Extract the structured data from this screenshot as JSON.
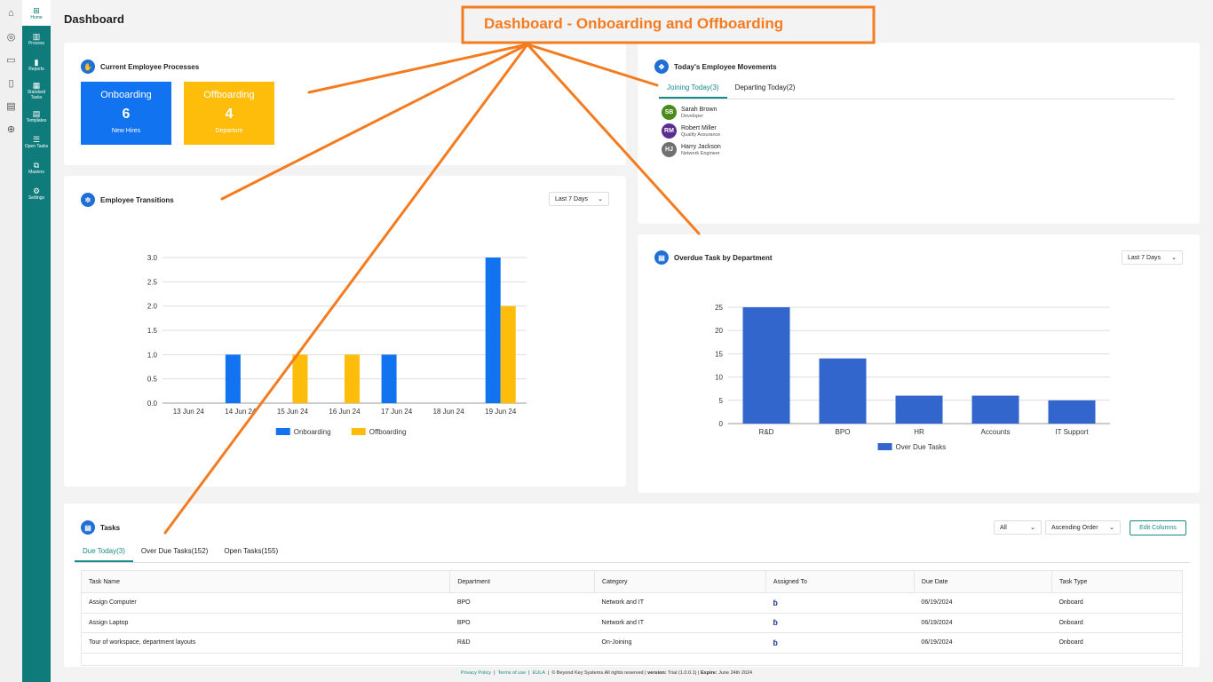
{
  "rail": {
    "icons": [
      "home-icon",
      "globe-icon",
      "id-card-icon",
      "document-icon",
      "database-icon",
      "plus-circle-icon"
    ]
  },
  "sidebar": {
    "items": [
      {
        "label": "Home",
        "icon": "grid-icon",
        "glyph": "⊞"
      },
      {
        "label": "Process",
        "icon": "briefcase-icon",
        "glyph": "▥"
      },
      {
        "label": "Reports",
        "icon": "bar-chart-icon",
        "glyph": "▮"
      },
      {
        "label": "Standard Tasks",
        "icon": "calendar-icon",
        "glyph": "▦"
      },
      {
        "label": "Templates",
        "icon": "template-icon",
        "glyph": "▤"
      },
      {
        "label": "Open Tasks",
        "icon": "list-icon",
        "glyph": "☰"
      },
      {
        "label": "Masters",
        "icon": "hierarchy-icon",
        "glyph": "⧉"
      },
      {
        "label": "Settings",
        "icon": "gear-icon",
        "glyph": "⚙"
      }
    ]
  },
  "page_title": "Dashboard",
  "annotation": {
    "title": "Dashboard - Onboarding and Offboarding",
    "color": "#f47b20"
  },
  "processes": {
    "title": "Current Employee Processes",
    "onboarding": {
      "label": "Onboarding",
      "count": "6",
      "sub": "New Hires",
      "color": "#1273f0"
    },
    "offboarding": {
      "label": "Offboarding",
      "count": "4",
      "sub": "Departure",
      "color": "#ffbd0b"
    }
  },
  "movements": {
    "title": "Today's Employee Movements",
    "tabs": [
      "Joining Today(3)",
      "Departing Today(2)"
    ],
    "people": [
      {
        "initials": "SB",
        "name": "Sarah Brown",
        "role": "Developer",
        "color": "#4a8a1c"
      },
      {
        "initials": "RM",
        "name": "Robert Miller",
        "role": "Quality Assurance",
        "color": "#5b2d90"
      },
      {
        "initials": "HJ",
        "name": "Harry Jackson",
        "role": "Network Engineer",
        "color": "#707070"
      }
    ]
  },
  "transitions": {
    "title": "Employee Transitions",
    "filter": "Last 7 Days"
  },
  "overdue": {
    "title": "Overdue Task by Department",
    "filter": "Last 7 Days"
  },
  "chart_data": [
    {
      "type": "bar",
      "categories": [
        "13 Jun 24",
        "14 Jun 24",
        "15 Jun 24",
        "16 Jun 24",
        "17 Jun 24",
        "18 Jun 24",
        "19 Jun 24"
      ],
      "series": [
        {
          "name": "Onboarding",
          "values": [
            0,
            1,
            0,
            0,
            1,
            0,
            3
          ],
          "color": "#1273f0"
        },
        {
          "name": "Offboarding",
          "values": [
            0,
            0,
            1,
            1,
            0,
            0,
            2
          ],
          "color": "#ffbd0b"
        }
      ],
      "ylim": [
        0,
        3
      ],
      "yticks": [
        "0.0",
        "0.5",
        "1.0",
        "1.5",
        "2.0",
        "2.5",
        "3.0"
      ],
      "grid": true,
      "legend": "bottom"
    },
    {
      "type": "bar",
      "categories": [
        "R&D",
        "BPO",
        "HR",
        "Accounts",
        "IT Support"
      ],
      "series": [
        {
          "name": "Over Due Tasks",
          "values": [
            25,
            14,
            6,
            6,
            5
          ],
          "color": "#3366cc"
        }
      ],
      "ylim": [
        0,
        25
      ],
      "yticks": [
        "0",
        "5",
        "10",
        "15",
        "20",
        "25"
      ],
      "grid": true,
      "legend": "bottom"
    }
  ],
  "tasks": {
    "title": "Tasks",
    "tabs": [
      "Due Today(3)",
      "Over Due Tasks(152)",
      "Open Tasks(155)"
    ],
    "filter_all": "All",
    "filter_order": "Ascending Order",
    "edit_columns": "Edit Columns",
    "columns": [
      "Task Name",
      "Department",
      "Category",
      "Assigned To",
      "Due Date",
      "Task Type"
    ],
    "rows": [
      [
        "Assign Computer",
        "BPO",
        "Network and IT",
        "",
        "06/19/2024",
        "Onboard"
      ],
      [
        "Assign Laptop",
        "BPO",
        "Network and IT",
        "",
        "06/19/2024",
        "Onboard"
      ],
      [
        "Tour of workspace, department layouts",
        "R&D",
        "On-Joining",
        "",
        "06/19/2024",
        "Onboard"
      ]
    ]
  },
  "footer": {
    "privacy": "Privacy Policy",
    "terms": "Terms of use",
    "eula": "EULA",
    "copyright": "© Beyond Key Systems.All rights reserved",
    "version_label": "version:",
    "version": "Trial (1.0.0.1)",
    "expire_label": "Expire:",
    "expire": "June 24th 2024"
  }
}
